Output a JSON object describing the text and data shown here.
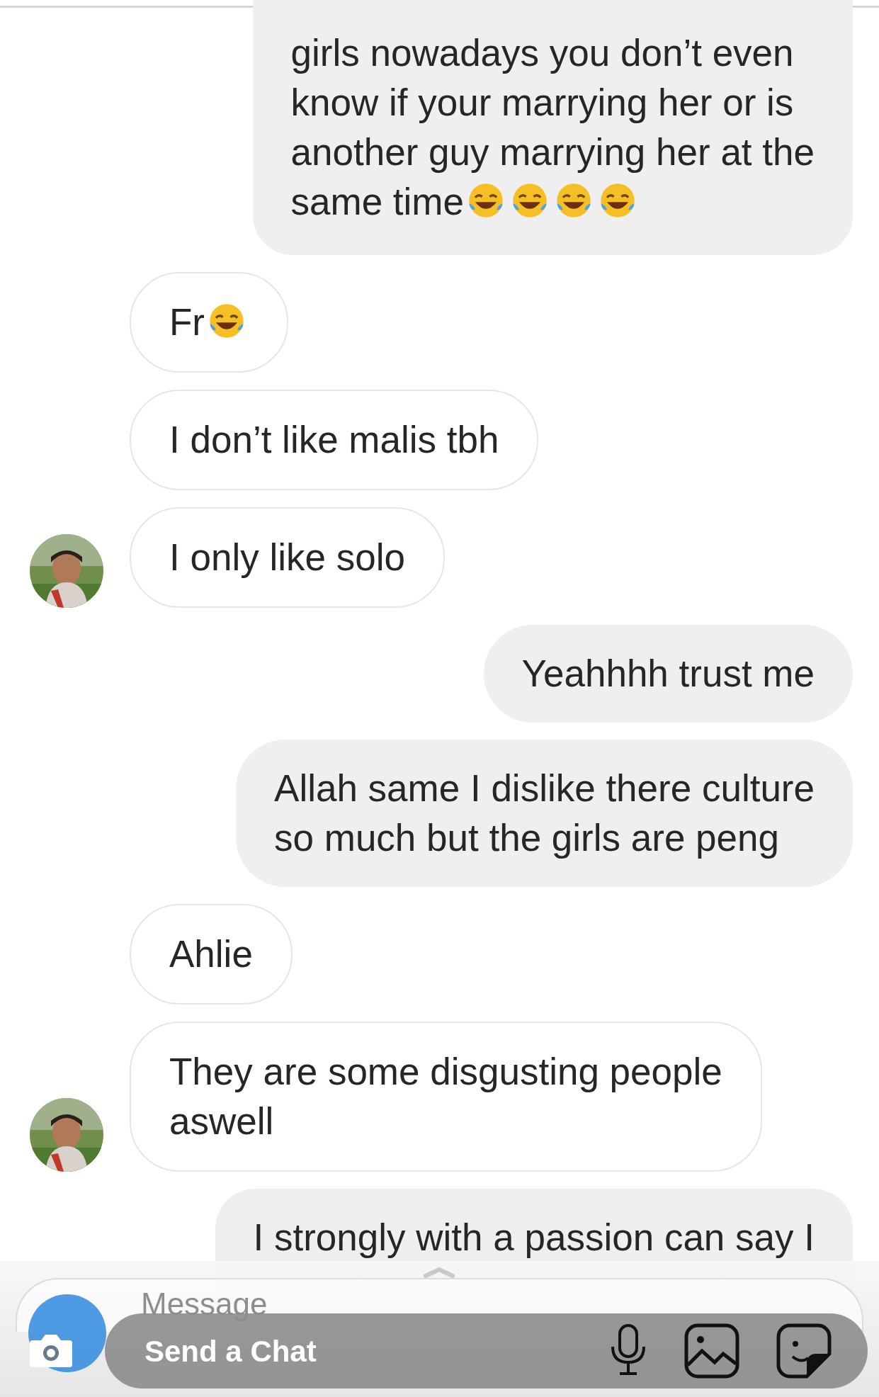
{
  "messages": [
    {
      "kind": "sent",
      "lines": [
        "girls nowadays you don’t even",
        "know if your marrying her or is",
        "another guy marrying her at the",
        "same time"
      ],
      "emojis": [
        {
          "kind": "laugh"
        },
        {
          "kind": "laugh"
        },
        {
          "kind": "laugh"
        },
        {
          "kind": "laugh"
        }
      ],
      "cut_top": true
    },
    {
      "kind": "received",
      "lines": [
        "Fr"
      ],
      "emojis": [
        {
          "kind": "laugh"
        }
      ],
      "avatar": false
    },
    {
      "kind": "received",
      "lines": [
        "I don’t like malis tbh"
      ],
      "avatar": false
    },
    {
      "kind": "received",
      "lines": [
        "I only like solo"
      ],
      "avatar": true
    },
    {
      "kind": "sent",
      "lines": [
        "Yeahhhh trust me"
      ]
    },
    {
      "kind": "sent",
      "lines": [
        "Allah same I dislike there culture",
        "so much but the girls are peng"
      ]
    },
    {
      "kind": "received",
      "lines": [
        "Ahlie"
      ],
      "avatar": false
    },
    {
      "kind": "received",
      "lines": [
        "They are some disgusting people",
        "aswell"
      ],
      "avatar": true
    },
    {
      "kind": "sent",
      "lines": [
        "I strongly with a passion can say I"
      ],
      "cut_bottom": true
    }
  ],
  "message_field": {
    "placeholder": "Message"
  },
  "chat_bar": {
    "placeholder": "Send a Chat"
  }
}
